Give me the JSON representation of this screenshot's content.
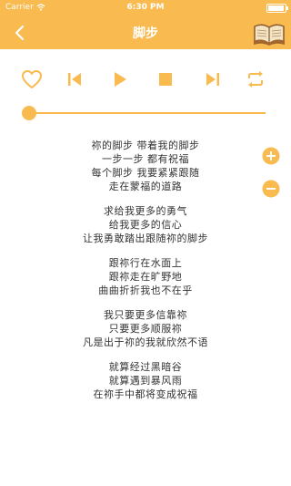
{
  "status_bar": {
    "carrier": "Carrier",
    "time": "6:30 PM",
    "battery_level": 0.95
  },
  "nav": {
    "title": "脚步",
    "back_icon": "chevron-left-icon",
    "book_icon": "open-book-icon"
  },
  "player": {
    "buttons": [
      "heart-icon",
      "skip-back-icon",
      "play-icon",
      "stop-icon",
      "skip-forward-icon",
      "repeat-icon"
    ],
    "progress": 0.0,
    "accent_color": "#f9ba4f"
  },
  "font_controls": {
    "increase_icon": "plus-circle-icon",
    "decrease_icon": "minus-circle-icon"
  },
  "lyrics": [
    [
      "祢的脚步 带着我的脚步",
      "一步一步 都有祝福",
      "每个脚步 我要紧紧跟随",
      "走在蒙福的道路"
    ],
    [
      "求给我更多的勇气",
      "给我更多的信心",
      "让我勇敢踏出跟随祢的脚步"
    ],
    [
      "跟祢行在水面上",
      "跟祢走在旷野地",
      "曲曲折折我也不在乎"
    ],
    [
      "我只要更多信靠祢",
      "只要更多顺服祢",
      "凡是出于祢的我就欣然不语"
    ],
    [
      "就算经过黑暗谷",
      "就算遇到暴风雨",
      "在祢手中都将变成祝福"
    ]
  ]
}
